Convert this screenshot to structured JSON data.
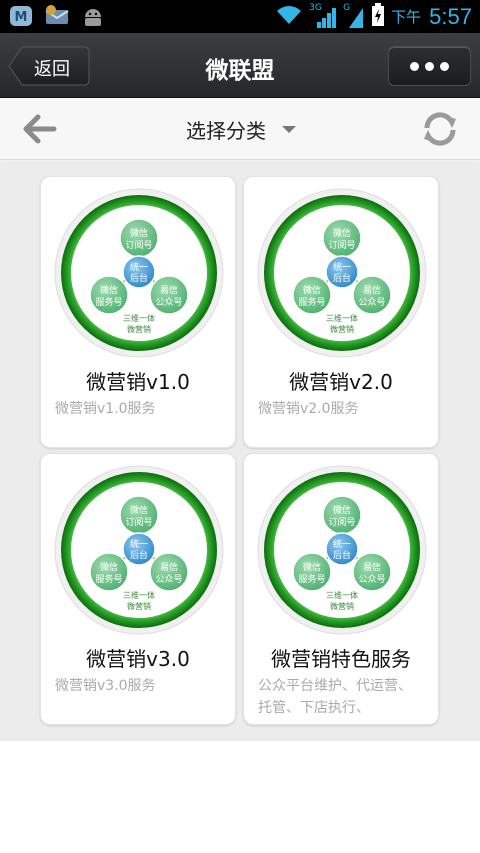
{
  "status_bar": {
    "network": "3G",
    "network2": "G",
    "ampm": "下午",
    "time": "5:57",
    "icons_left": [
      "maxthon-icon",
      "mail-icon",
      "android-icon"
    ],
    "accent_color": "#33b5e5"
  },
  "header": {
    "back_label": "返回",
    "title": "微联盟"
  },
  "category_bar": {
    "label": "选择分类"
  },
  "logo_text": {
    "top": [
      "微信",
      "订阅号"
    ],
    "left": [
      "微信",
      "服务号"
    ],
    "right": [
      "易信",
      "公众号"
    ],
    "center": [
      "统一",
      "后台"
    ],
    "bottom": [
      "三维一体",
      "微营销"
    ]
  },
  "cards": [
    {
      "title": "微营销v1.0",
      "desc": "微营销v1.0服务"
    },
    {
      "title": "微营销v2.0",
      "desc": "微营销v2.0服务"
    },
    {
      "title": "微营销v3.0",
      "desc": "微营销v3.0服务"
    },
    {
      "title": "微营销特色服务",
      "desc": "公众平台维护、代运营、托管、下店执行、"
    }
  ],
  "colors": {
    "ring_green": "#2fa82f",
    "node_green": "#4cae6e",
    "node_blue": "#2a86c8",
    "card_bg": "#ffffff",
    "grid_bg": "#ececec"
  }
}
